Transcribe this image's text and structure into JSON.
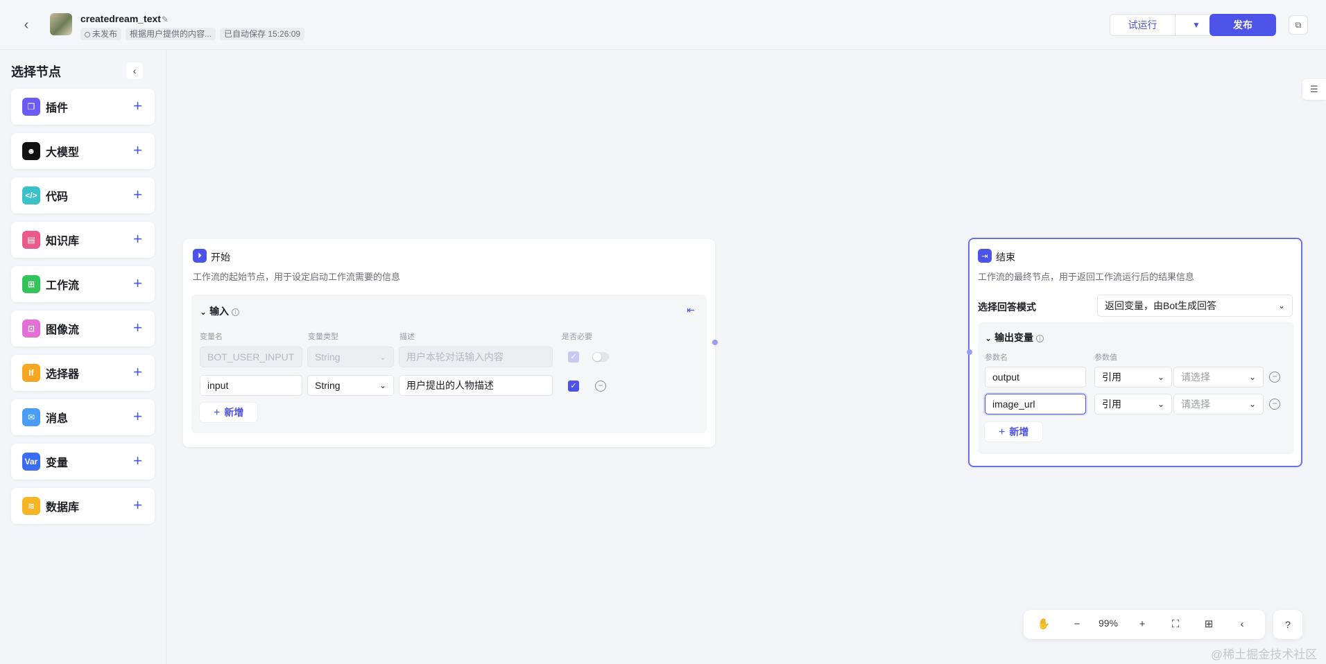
{
  "header": {
    "title": "createdream_text",
    "status": "未发布",
    "description": "根据用户提供的内容...",
    "autosave": "已自动保存 15:26:09",
    "trial_run_label": "试运行",
    "publish_label": "发布"
  },
  "sidebar": {
    "title": "选择节点",
    "items": [
      {
        "label": "插件",
        "icon": "plugin-icon",
        "color": "#6b5cf6"
      },
      {
        "label": "大模型",
        "icon": "llm-icon",
        "color": "#111111"
      },
      {
        "label": "代码",
        "icon": "code-icon",
        "color": "#3bc2c9"
      },
      {
        "label": "知识库",
        "icon": "knowledge-icon",
        "color": "#ea5a8a"
      },
      {
        "label": "工作流",
        "icon": "workflow-icon",
        "color": "#35c45a"
      },
      {
        "label": "图像流",
        "icon": "imageflow-icon",
        "color": "#e46fd6"
      },
      {
        "label": "选择器",
        "icon": "selector-icon",
        "color": "#f6a623"
      },
      {
        "label": "消息",
        "icon": "message-icon",
        "color": "#4a9cf5"
      },
      {
        "label": "变量",
        "icon": "variable-icon",
        "color": "#3b6cf5"
      },
      {
        "label": "数据库",
        "icon": "database-icon",
        "color": "#f6b623"
      }
    ],
    "icon_glyphs": {
      "plugin-icon": "❒",
      "llm-icon": "☻",
      "code-icon": "</>",
      "knowledge-icon": "▤",
      "workflow-icon": "⊞",
      "imageflow-icon": "⊡",
      "selector-icon": "If",
      "message-icon": "✉",
      "variable-icon": "Var",
      "database-icon": "≋"
    }
  },
  "start_node": {
    "title": "开始",
    "description": "工作流的起始节点，用于设定启动工作流需要的信息",
    "input_section_title": "输入",
    "columns": {
      "name": "变量名",
      "type": "变量类型",
      "desc": "描述",
      "required": "是否必要"
    },
    "rows": [
      {
        "name": "BOT_USER_INPUT",
        "type": "String",
        "desc": "用户本轮对话输入内容",
        "required": true,
        "disabled": true
      },
      {
        "name": "input",
        "type": "String",
        "desc": "用户提出的人物描述",
        "required": true,
        "disabled": false
      }
    ],
    "add_label": "新增"
  },
  "end_node": {
    "title": "结束",
    "description": "工作流的最终节点，用于返回工作流运行后的结果信息",
    "answer_mode_label": "选择回答模式",
    "answer_mode_value": "返回变量，由Bot生成回答",
    "output_section_title": "输出变量",
    "columns": {
      "name": "参数名",
      "value": "参数值"
    },
    "rows": [
      {
        "name": "output",
        "ref": "引用",
        "value": "请选择"
      },
      {
        "name": "image_url",
        "ref": "引用",
        "value": "请选择"
      }
    ],
    "add_label": "新增"
  },
  "toolbar": {
    "zoom": "99%"
  },
  "watermark": "@稀土掘金技术社区"
}
